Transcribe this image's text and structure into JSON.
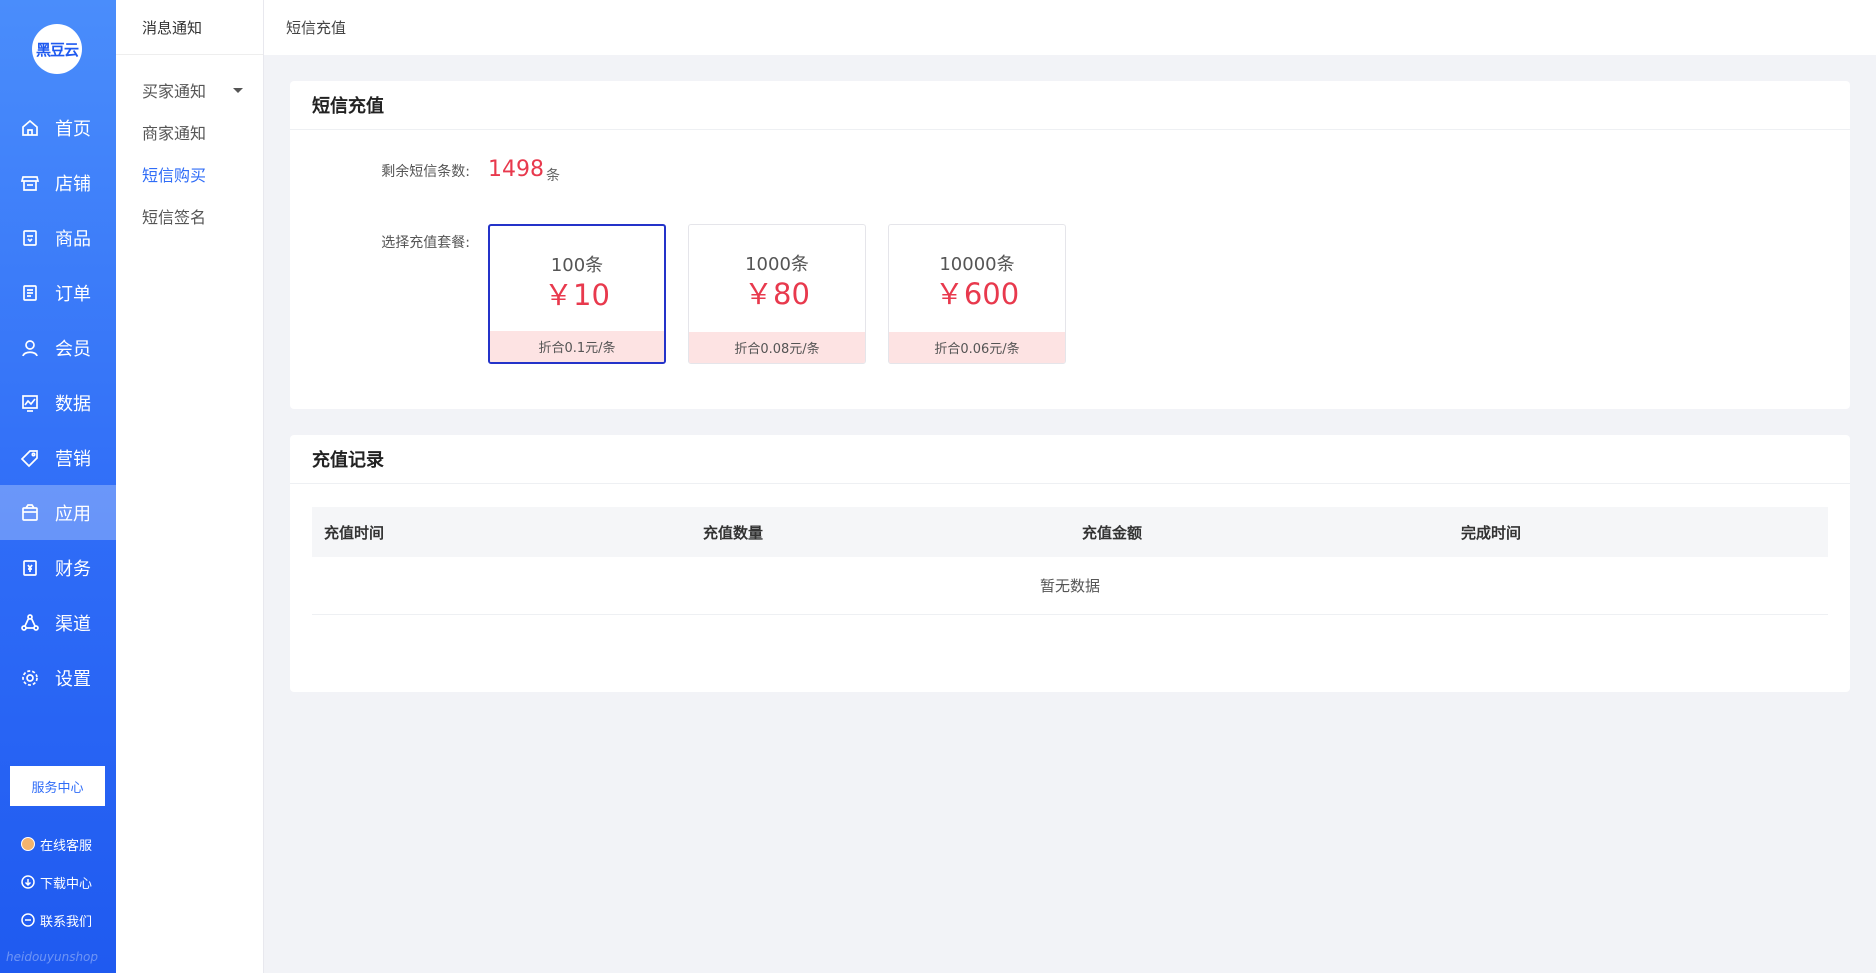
{
  "brand": {
    "logo_text": "黑豆云",
    "watermark": "heidouyunshop"
  },
  "nav": [
    {
      "label": "首页",
      "icon": "home-icon"
    },
    {
      "label": "店铺",
      "icon": "store-icon"
    },
    {
      "label": "商品",
      "icon": "goods-icon"
    },
    {
      "label": "订单",
      "icon": "order-icon"
    },
    {
      "label": "会员",
      "icon": "member-icon"
    },
    {
      "label": "数据",
      "icon": "data-icon"
    },
    {
      "label": "营销",
      "icon": "tag-icon"
    },
    {
      "label": "应用",
      "icon": "app-box-icon",
      "active": true
    },
    {
      "label": "财务",
      "icon": "finance-icon"
    },
    {
      "label": "渠道",
      "icon": "channel-icon"
    },
    {
      "label": "设置",
      "icon": "settings-icon"
    }
  ],
  "service": {
    "button_label": "服务中心",
    "links": [
      {
        "label": "在线客服",
        "icon": "avatar-icon"
      },
      {
        "label": "下载中心",
        "icon": "download-icon"
      },
      {
        "label": "联系我们",
        "icon": "contact-icon"
      }
    ]
  },
  "subnav": {
    "title": "消息通知",
    "items": [
      {
        "label": "买家通知",
        "expandable": true
      },
      {
        "label": "商家通知"
      },
      {
        "label": "短信购买",
        "active": true
      },
      {
        "label": "短信签名"
      }
    ]
  },
  "topbar": {
    "breadcrumb": "短信充值"
  },
  "recharge": {
    "title": "短信充值",
    "remain_label": "剩余短信条数:",
    "remain_value": "1498",
    "remain_unit": "条",
    "package_label": "选择充值套餐:",
    "packages": [
      {
        "count": "100条",
        "price": "￥10",
        "rate": "折合0.1元/条",
        "selected": true
      },
      {
        "count": "1000条",
        "price": "￥80",
        "rate": "折合0.08元/条"
      },
      {
        "count": "10000条",
        "price": "￥600",
        "rate": "折合0.06元/条"
      }
    ],
    "colors": {
      "price": "#e8394d",
      "selected_border": "#2433c9",
      "rate_bg": "#fde3e3"
    }
  },
  "records": {
    "title": "充值记录",
    "columns": [
      "充值时间",
      "充值数量",
      "充值金额",
      "完成时间"
    ],
    "empty_text": "暂无数据"
  }
}
